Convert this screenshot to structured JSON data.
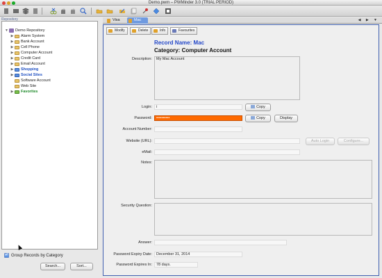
{
  "window": {
    "title": "Demo.pwm – PWMinder 3.0 (TRIAL PERIOD)"
  },
  "toolbar": {
    "icons": [
      "new-document-icon",
      "open-icon",
      "save-icon",
      "document-icon",
      "cut-icon",
      "copy-icon",
      "paste-icon",
      "search-icon",
      "open-folder-icon",
      "folder-icon",
      "edit-folder-icon",
      "document-stack-icon",
      "pin-icon",
      "diamond-icon",
      "info-icon"
    ]
  },
  "sidebar": {
    "header": "Repository",
    "root": "Demo Repository",
    "items": [
      {
        "label": "Alarm System",
        "style": "normal"
      },
      {
        "label": "Bank Account",
        "style": "normal"
      },
      {
        "label": "Cell Phone",
        "style": "normal"
      },
      {
        "label": "Computer Account",
        "style": "normal"
      },
      {
        "label": "Credit Card",
        "style": "normal"
      },
      {
        "label": "Email Account",
        "style": "normal"
      },
      {
        "label": "Shopping",
        "style": "blue"
      },
      {
        "label": "Social Sites",
        "style": "blue"
      },
      {
        "label": "Software Account",
        "style": "normal"
      },
      {
        "label": "Web Site",
        "style": "normal"
      },
      {
        "label": "Favorites",
        "style": "green"
      }
    ],
    "group_by_category": "Group Records by Category",
    "search_button": "Search...",
    "sort_button": "Sort..."
  },
  "tabs": [
    {
      "label": "Visa",
      "active": false
    },
    {
      "label": "Mac",
      "active": true
    }
  ],
  "tab_nav": "◀ ▶ ▼",
  "actions": {
    "modify": "Modify",
    "delete": "Delete",
    "info": "Info",
    "favourites": "Favourites"
  },
  "record": {
    "name_line": "Record Name: Mac",
    "category_line": "Category: Computer Account",
    "labels": {
      "description": "Description:",
      "login": "Login:",
      "password": "Password:",
      "account_number": "Account Number:",
      "website": "Website (URL):",
      "email": "eMail:",
      "notes": "Notes:",
      "security_question": "Security Question:",
      "answer": "Answer:",
      "expiry_date": "Password Expiry Date:",
      "expires_in": "Password Expires In:"
    },
    "description": "My Mac Account",
    "login": "i",
    "password": "••••••••••",
    "account_number": "",
    "website": "",
    "email": "",
    "notes": "",
    "security_question": "",
    "answer": "",
    "expiry_date": "December 31, 2014",
    "expires_in": "78 days."
  },
  "buttons": {
    "copy": "Copy",
    "display": "Display",
    "auto_login": "Auto Login",
    "configure": "Configure..."
  },
  "colors": {
    "accent": "#2246c8",
    "password_bg": "#ff6a00",
    "favorites": "#1f8a2a"
  }
}
